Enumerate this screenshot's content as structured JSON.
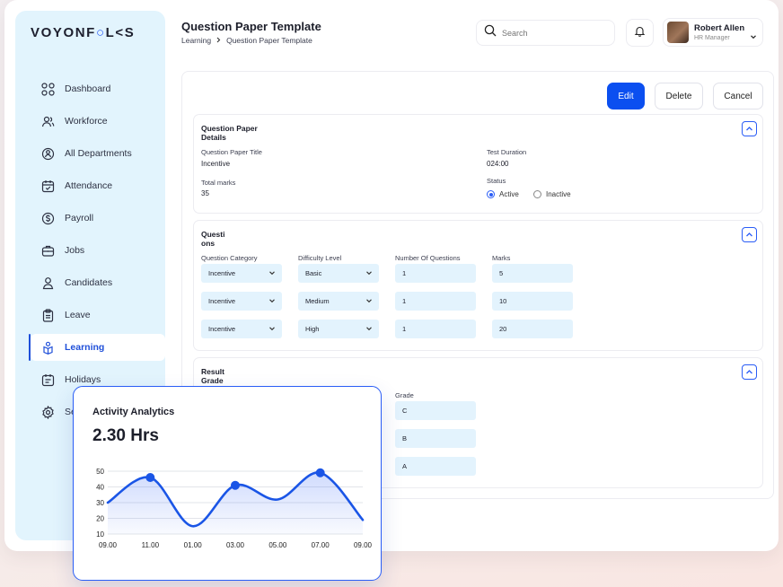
{
  "app": {
    "logo": "VOYONF○L<S"
  },
  "sidebar": {
    "items": [
      {
        "label": "Dashboard",
        "icon": "grid-icon"
      },
      {
        "label": "Workforce",
        "icon": "users-icon"
      },
      {
        "label": "All Departments",
        "icon": "departments-icon"
      },
      {
        "label": "Attendance",
        "icon": "calendar-check-icon"
      },
      {
        "label": "Payroll",
        "icon": "dollar-icon"
      },
      {
        "label": "Jobs",
        "icon": "briefcase-icon"
      },
      {
        "label": "Candidates",
        "icon": "candidates-icon"
      },
      {
        "label": "Leave",
        "icon": "clipboard-icon"
      },
      {
        "label": "Learning",
        "icon": "learning-icon",
        "active": true
      },
      {
        "label": "Holidays",
        "icon": "holidays-icon"
      },
      {
        "label": "Se",
        "icon": "settings-icon"
      }
    ]
  },
  "header": {
    "title": "Question Paper Template",
    "breadcrumb": [
      "Learning",
      "Question Paper Template"
    ]
  },
  "search": {
    "placeholder": "Search"
  },
  "user": {
    "name": "Robert Allen",
    "role": "HR Manager"
  },
  "actions": {
    "edit": "Edit",
    "delete": "Delete",
    "cancel": "Cancel"
  },
  "details": {
    "title_line1": "Question Paper",
    "title_line2": "Details",
    "paper_title_label": "Question Paper Title",
    "paper_title_value": "Incentive",
    "duration_label": "Test Duration",
    "duration_value": "024:00",
    "total_marks_label": "Total marks",
    "total_marks_value": "35",
    "status_label": "Status",
    "status_options": [
      "Active",
      "Inactive"
    ],
    "status_selected": "Active"
  },
  "questions": {
    "title_line1": "Questi",
    "title_line2": "ons",
    "headers": [
      "Question Category",
      "Difficulty Level",
      "Number Of Questions",
      "Marks"
    ],
    "rows": [
      {
        "category": "Incentive",
        "difficulty": "Basic",
        "count": "1",
        "marks": "5"
      },
      {
        "category": "Incentive",
        "difficulty": "Medium",
        "count": "1",
        "marks": "10"
      },
      {
        "category": "Incentive",
        "difficulty": "High",
        "count": "1",
        "marks": "20"
      }
    ]
  },
  "result": {
    "title_line1": "Result",
    "title_line2": "Grade",
    "grade_header": "Grade",
    "grades": [
      "C",
      "B",
      "A"
    ]
  },
  "analytics": {
    "title": "Activity Analytics",
    "value": "2.30 Hrs"
  },
  "chart_data": {
    "type": "line",
    "x": [
      "09.00",
      "11.00",
      "01.00",
      "03.00",
      "05.00",
      "07.00",
      "09.00"
    ],
    "y": [
      30,
      46,
      15,
      41,
      32,
      49,
      19
    ],
    "markers_at": [
      1,
      3,
      5
    ],
    "ylim": [
      10,
      50
    ],
    "yticks": [
      50,
      40,
      30,
      20,
      10
    ],
    "grid": true,
    "color": "#1a55e6"
  }
}
